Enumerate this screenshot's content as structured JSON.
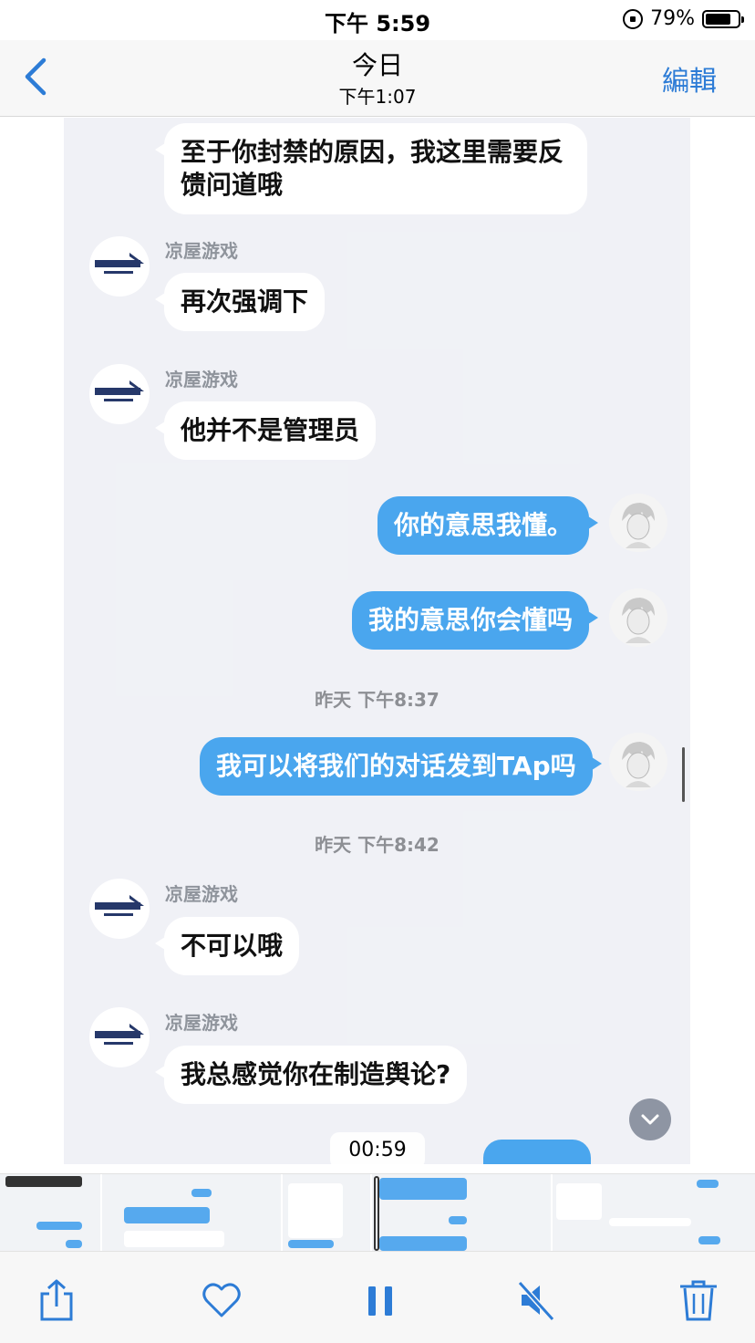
{
  "status_bar": {
    "time": "下午 5:59",
    "battery": "79%",
    "battery_level": 0.79
  },
  "nav": {
    "title": "今日",
    "subtitle": "下午1:07",
    "edit_label": "編輯"
  },
  "chat": {
    "messages": [
      {
        "text": "至于你封禁的原因，我这里需要反馈问道哦"
      },
      {
        "sender": "凉屋游戏",
        "text": "再次强调下"
      },
      {
        "sender": "凉屋游戏",
        "text": "他并不是管理员"
      },
      {
        "text": "你的意思我懂。"
      },
      {
        "text": "我的意思你会懂吗"
      },
      {
        "timestamp": "昨天 下午8:37"
      },
      {
        "text": "我可以将我们的对话发到TAp吗"
      },
      {
        "timestamp": "昨天 下午8:42"
      },
      {
        "sender": "凉屋游戏",
        "text": "不可以哦"
      },
      {
        "sender": "凉屋游戏",
        "text": "我总感觉你在制造舆论?"
      }
    ]
  },
  "video": {
    "time": "00:59"
  },
  "colors": {
    "accent": "#2d7cd6",
    "outgoing_bubble": "#4aa6ee",
    "incoming_bubble": "#ffffff",
    "chat_bg": "#eef0f5"
  },
  "toolbar": {
    "share_icon": "share-icon",
    "like_icon": "heart-icon",
    "pause_icon": "pause-icon",
    "mute_icon": "speaker-muted-icon",
    "delete_icon": "trash-icon"
  }
}
